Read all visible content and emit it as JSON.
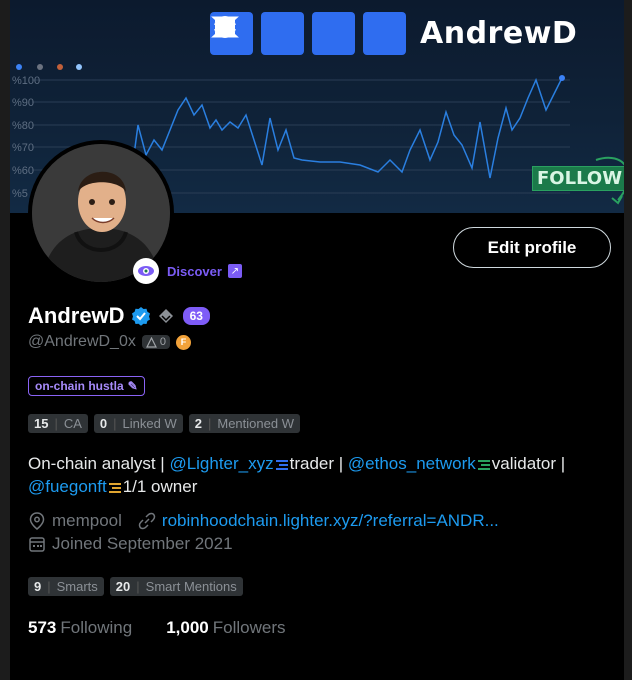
{
  "banner": {
    "brand_name": "AndrewD",
    "follow_tag": "FOLLOW",
    "chart_y_labels": [
      "%100",
      "%90",
      "%80",
      "%70",
      "%60",
      "%5"
    ],
    "line_color": "#2a7fe0",
    "legend_dot_colors": [
      "#3b82f6",
      "#6b7280",
      "#c2603a",
      "#93c5fd"
    ]
  },
  "avatar": {
    "alt": "cartoon avatar"
  },
  "discover": {
    "label": "Discover",
    "icon": "eye-icon"
  },
  "edit_profile_label": "Edit profile",
  "profile": {
    "display_name": "AndrewD",
    "score": "63",
    "handle": "@AndrewD_0x",
    "handle_pill_count": "0",
    "orange_badge": "F",
    "tag": "on-chain hustla"
  },
  "counts": [
    {
      "num": "15",
      "label": "CA"
    },
    {
      "num": "0",
      "label": "Linked W"
    },
    {
      "num": "2",
      "label": "Mentioned W"
    }
  ],
  "bio": {
    "p1": "On-chain analyst | ",
    "link1": "@Lighter_xyz",
    "p2": "trader | ",
    "link2": "@ethos_network",
    "p3": "validator |",
    "link3": "@fuegonft",
    "p4": "1/1 owner"
  },
  "meta": {
    "location": "mempool",
    "website": "robinhoodchain.lighter.xyz/?referral=ANDR...",
    "joined": "Joined September 2021"
  },
  "smart": [
    {
      "num": "9",
      "label": "Smarts"
    },
    {
      "num": "20",
      "label": "Smart Mentions"
    }
  ],
  "follow": {
    "following_num": "573",
    "following_label": "Following",
    "followers_num": "1,000",
    "followers_label": "Followers"
  }
}
